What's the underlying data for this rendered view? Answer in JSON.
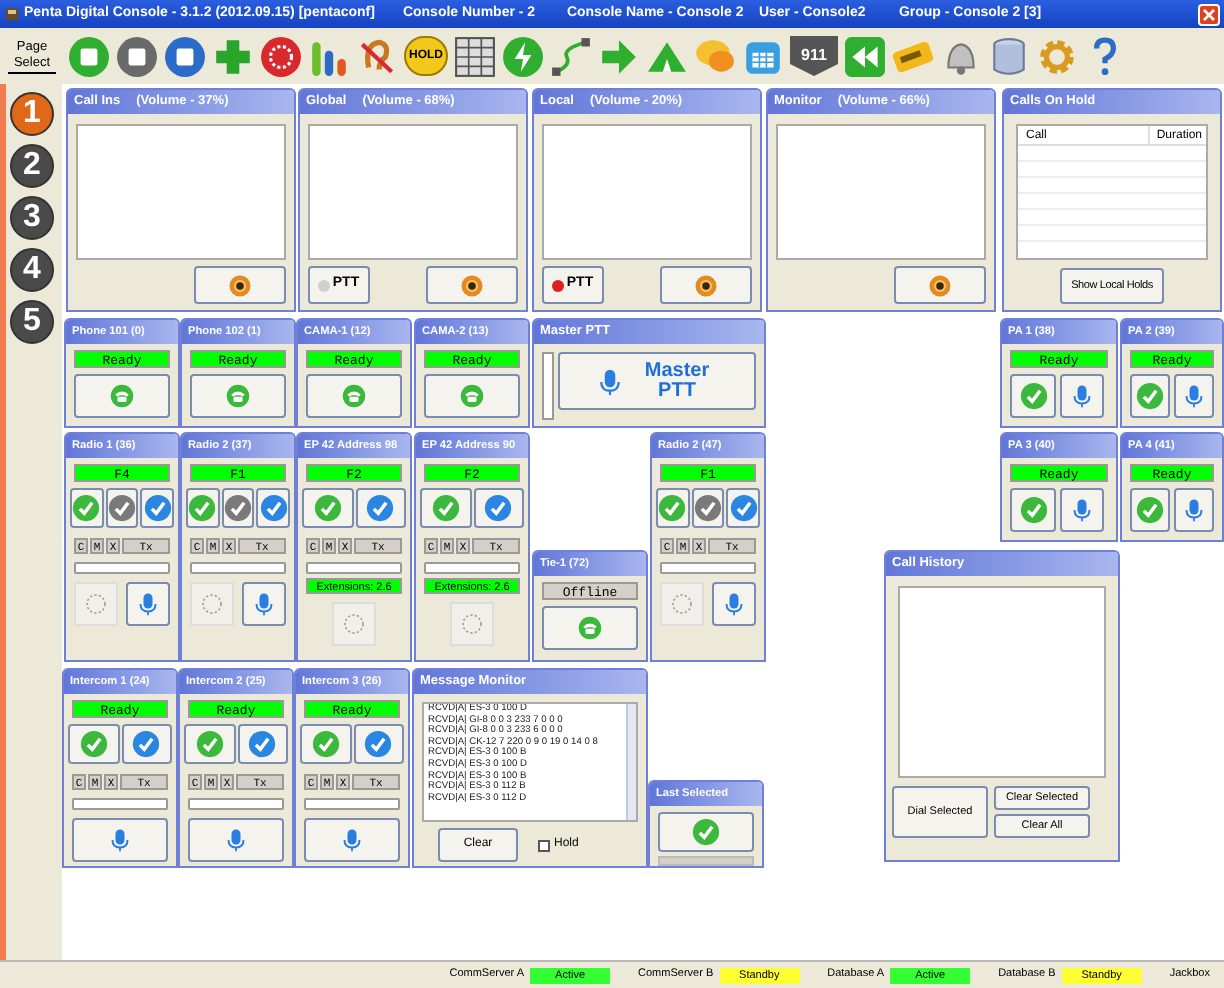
{
  "window": {
    "title": "Penta Digital Console - 3.1.2 (2012.09.15) [pentaconf]",
    "fields": [
      "Console Number - 2",
      "Console Name - Console 2",
      "User - Console2",
      "Group - Console 2 [3]"
    ]
  },
  "toolbar": {
    "page_select": "Page Select",
    "hold": "HOLD",
    "emergency": "911"
  },
  "pages": [
    {
      "label": "1",
      "selected": true
    },
    {
      "label": "2",
      "selected": false
    },
    {
      "label": "3",
      "selected": false
    },
    {
      "label": "4",
      "selected": false
    },
    {
      "label": "5",
      "selected": false
    }
  ],
  "tiles": [
    {
      "kind": "audio",
      "title": "Call Ins",
      "volume": "(Volume - 37%)"
    },
    {
      "kind": "audio",
      "title": "Global",
      "volume": "(Volume - 68%)",
      "ptt": {
        "label": "PTT",
        "active": false
      }
    },
    {
      "kind": "audio",
      "title": "Local",
      "volume": "(Volume - 20%)",
      "ptt": {
        "label": "PTT",
        "active": true
      }
    },
    {
      "kind": "audio",
      "title": "Monitor",
      "volume": "(Volume - 66%)"
    },
    {
      "kind": "holds",
      "title": "Calls On Hold",
      "columns": [
        "Call",
        "Duration"
      ],
      "button": "Show Local Holds"
    },
    {
      "kind": "phone",
      "title": "Phone 101 (0)",
      "status": {
        "text": "Ready",
        "color": "#00ff00"
      }
    },
    {
      "kind": "phone",
      "title": "Phone 102 (1)",
      "status": {
        "text": "Ready",
        "color": "#00ff00"
      }
    },
    {
      "kind": "phone",
      "title": "CAMA-1 (12)",
      "status": {
        "text": "Ready",
        "color": "#00ff00"
      }
    },
    {
      "kind": "phone",
      "title": "CAMA-2 (13)",
      "status": {
        "text": "Ready",
        "color": "#00ff00"
      }
    },
    {
      "kind": "master_ptt",
      "title": "Master PTT",
      "button": "Master PTT"
    },
    {
      "kind": "pa",
      "title": "PA 1 (38)",
      "status": {
        "text": "Ready",
        "color": "#00ff00"
      }
    },
    {
      "kind": "pa",
      "title": "PA 2 (39)",
      "status": {
        "text": "Ready",
        "color": "#00ff00"
      }
    },
    {
      "kind": "radio",
      "title": "Radio 1 (36)",
      "level": 0,
      "status": {
        "text": "F4",
        "color": "#00ff00"
      },
      "checks": [
        {
          "color": "#3cb93c"
        },
        {
          "color": "#7a7a7a"
        },
        {
          "color": "#2a86e0"
        }
      ],
      "flags": [
        "C",
        "M",
        "X",
        "Tx"
      ],
      "mic": true
    },
    {
      "kind": "radio",
      "title": "Radio 2 (37)",
      "level": 0,
      "status": {
        "text": "F1",
        "color": "#00ff00"
      },
      "checks": [
        {
          "color": "#3cb93c"
        },
        {
          "color": "#7a7a7a"
        },
        {
          "color": "#2a86e0"
        }
      ],
      "flags": [
        "C",
        "M",
        "X",
        "Tx"
      ],
      "mic": true
    },
    {
      "kind": "radio",
      "title": "EP 42 Address 98",
      "level": 0,
      "status": {
        "text": "F2",
        "color": "#00ff00"
      },
      "checks": [
        {
          "color": "#3cb93c"
        },
        {
          "color": "#2a86e0"
        }
      ],
      "flags": [
        "C",
        "M",
        "X",
        "Tx"
      ],
      "extensions": {
        "text": "Extensions: 2.6",
        "color": "#00ff00"
      },
      "mic": false
    },
    {
      "kind": "radio",
      "title": "EP 42 Address 90",
      "level": 0,
      "status": {
        "text": "F2",
        "color": "#00ff00"
      },
      "checks": [
        {
          "color": "#3cb93c"
        },
        {
          "color": "#2a86e0"
        }
      ],
      "flags": [
        "C",
        "M",
        "X",
        "Tx"
      ],
      "extensions": {
        "text": "Extensions: 2.6",
        "color": "#00ff00"
      },
      "mic": false
    },
    {
      "kind": "radio",
      "title": "Radio 2 (47)",
      "level": 0,
      "status": {
        "text": "F1",
        "color": "#00ff00"
      },
      "checks": [
        {
          "color": "#3cb93c"
        },
        {
          "color": "#7a7a7a"
        },
        {
          "color": "#2a86e0"
        }
      ],
      "flags": [
        "C",
        "M",
        "X",
        "Tx"
      ],
      "mic": true
    },
    {
      "kind": "pa",
      "title": "PA 3 (40)",
      "status": {
        "text": "Ready",
        "color": "#00ff00"
      }
    },
    {
      "kind": "pa",
      "title": "PA 4 (41)",
      "status": {
        "text": "Ready",
        "color": "#00ff00"
      }
    },
    {
      "kind": "phone",
      "title": "Tie-1 (72)",
      "status": {
        "text": "Offline",
        "color": "#d4d0c8"
      }
    },
    {
      "kind": "call_history",
      "title": "Call History",
      "buttons": [
        "Dial Selected",
        "Clear Selected",
        "Clear All"
      ]
    },
    {
      "kind": "radio",
      "title": "Intercom 1 (24)",
      "level": 0,
      "status": {
        "text": "Ready",
        "color": "#00ff00"
      },
      "checks": [
        {
          "color": "#3cb93c"
        },
        {
          "color": "#2a86e0"
        }
      ],
      "flags": [
        "C",
        "M",
        "X",
        "Tx"
      ],
      "mic": true
    },
    {
      "kind": "radio",
      "title": "Intercom 2 (25)",
      "level": 0,
      "status": {
        "text": "Ready",
        "color": "#00ff00"
      },
      "checks": [
        {
          "color": "#3cb93c"
        },
        {
          "color": "#2a86e0"
        }
      ],
      "flags": [
        "C",
        "M",
        "X",
        "Tx"
      ],
      "mic": true
    },
    {
      "kind": "radio",
      "title": "Intercom 3 (26)",
      "level": 0,
      "status": {
        "text": "Ready",
        "color": "#00ff00"
      },
      "checks": [
        {
          "color": "#3cb93c"
        },
        {
          "color": "#2a86e0"
        }
      ],
      "flags": [
        "C",
        "M",
        "X",
        "Tx"
      ],
      "mic": true
    },
    {
      "kind": "message_monitor",
      "title": "Message Monitor",
      "lines": [
        "RCVD|A| ES-3 0 100 D",
        "RCVD|A| GI-8 0 0 3 233 7 0 0 0",
        "RCVD|A| GI-8 0 0 3 233 6 0 0 0",
        "RCVD|A| CK-12 7 220 0 9 0 19 0 14 0 8",
        "RCVD|A| ES-3 0 100 B",
        "RCVD|A| ES-3 0 100 D",
        "RCVD|A| ES-3 0 100 B",
        "RCVD|A| ES-3 0 112 B",
        "RCVD|A| ES-3 0 112 D"
      ],
      "clear": "Clear",
      "hold": {
        "label": "Hold",
        "checked": false
      }
    },
    {
      "kind": "last_selected",
      "title": "Last Selected",
      "level": 0
    }
  ],
  "status_bar": [
    {
      "label": "CommServer A",
      "state": "Active",
      "color": "#33ff33"
    },
    {
      "label": "CommServer B",
      "state": "Standby",
      "color": "#ffff33"
    },
    {
      "label": "Database A",
      "state": "Active",
      "color": "#33ff33"
    },
    {
      "label": "Database B",
      "state": "Standby",
      "color": "#ffff33"
    },
    {
      "label": "Jackbox"
    }
  ]
}
